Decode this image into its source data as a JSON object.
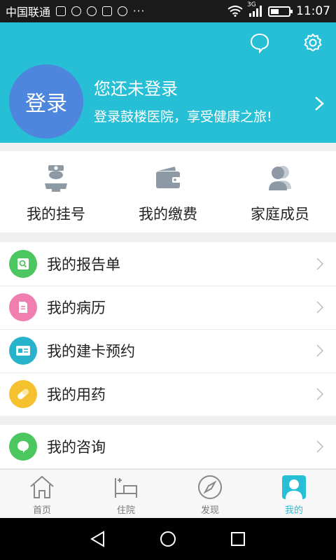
{
  "status_bar": {
    "carrier": "中国联通",
    "network": "3G",
    "time": "11:07",
    "battery_level": 0.45,
    "notification_icons": [
      "sim-icon",
      "message-icon",
      "chat-bubble-icon",
      "image-icon",
      "blocked-icon"
    ],
    "more": "···"
  },
  "header": {
    "avatar_text": "登录",
    "title": "您还未登录",
    "subtitle": "登录鼓楼医院，享受健康之旅!",
    "background": "#27bfd6",
    "avatar_color": "#4f86dd"
  },
  "quick_actions": [
    {
      "label": "我的挂号",
      "icon": "doctor-icon"
    },
    {
      "label": "我的缴费",
      "icon": "wallet-icon"
    },
    {
      "label": "家庭成员",
      "icon": "family-icon"
    }
  ],
  "menu_group_1": [
    {
      "label": "我的报告单",
      "icon": "report-icon",
      "color": "#4cc65e"
    },
    {
      "label": "我的病历",
      "icon": "medical-record-icon",
      "color": "#f07fb0"
    },
    {
      "label": "我的建卡预约",
      "icon": "card-icon",
      "color": "#27b3cc"
    },
    {
      "label": "我的用药",
      "icon": "pill-icon",
      "color": "#f6c12f"
    }
  ],
  "menu_group_2": [
    {
      "label": "我的咨询",
      "icon": "consult-icon",
      "color": "#4cc65e"
    }
  ],
  "tabs": [
    {
      "label": "首页",
      "icon": "home-icon"
    },
    {
      "label": "住院",
      "icon": "bed-icon"
    },
    {
      "label": "发现",
      "icon": "compass-icon"
    },
    {
      "label": "我的",
      "icon": "profile-icon"
    }
  ],
  "active_tab": 3
}
